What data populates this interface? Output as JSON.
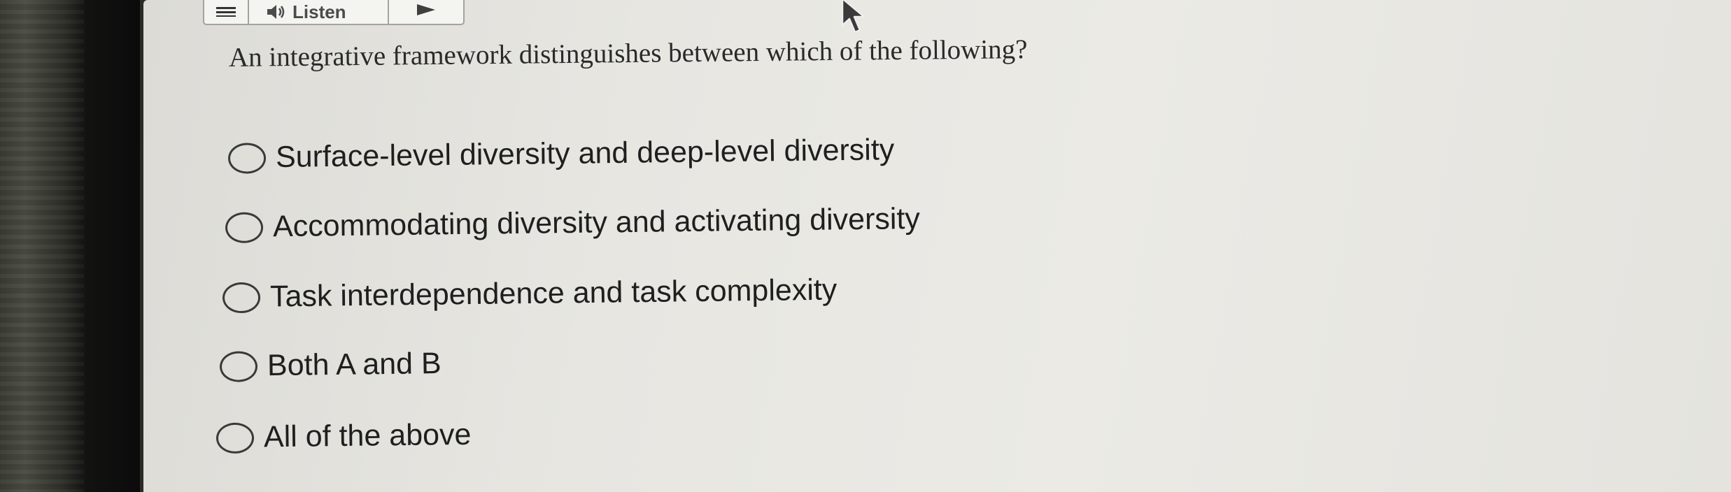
{
  "toolbar": {
    "menu_icon": "hamburger-menu-icon",
    "listen_label": "Listen",
    "speaker_icon": "speaker-icon",
    "play_icon": "play-icon"
  },
  "question": {
    "text": "An integrative framework distinguishes between which of the following?"
  },
  "options": [
    {
      "label": "Surface-level diversity and deep-level diversity",
      "selected": false
    },
    {
      "label": "Accommodating diversity and activating diversity",
      "selected": false
    },
    {
      "label": "Task interdependence and task complexity",
      "selected": false
    },
    {
      "label": "Both A and B",
      "selected": false
    },
    {
      "label": "All of the above",
      "selected": false
    }
  ],
  "colors": {
    "screen_bg": "#e7e6e1",
    "text": "#1f1f1f",
    "radio_border": "#3a3a3a"
  }
}
